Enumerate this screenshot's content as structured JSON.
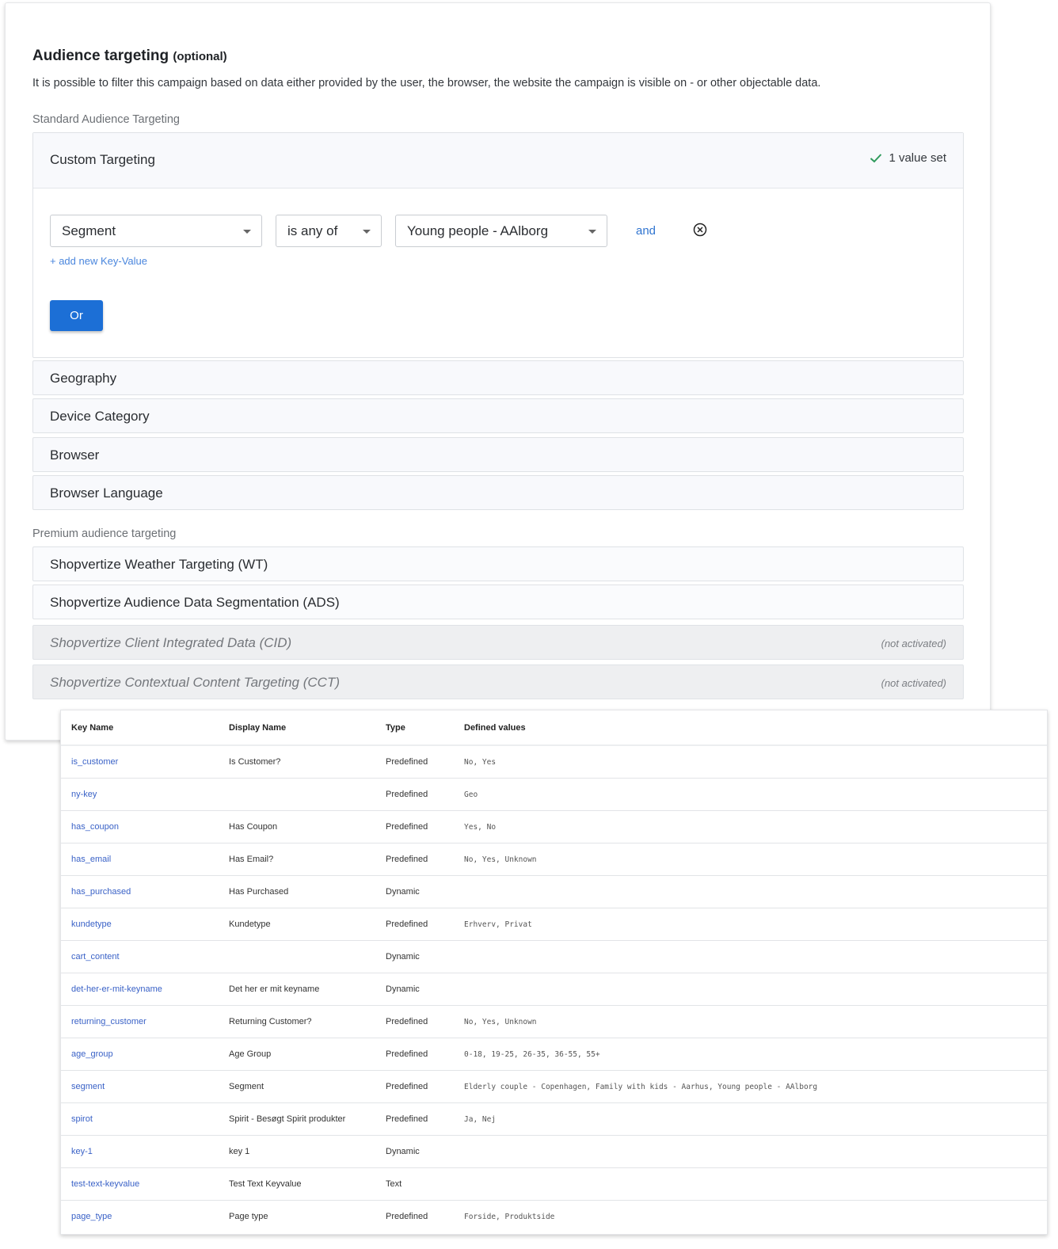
{
  "header": {
    "title": "Audience targeting",
    "title_suffix": "(optional)",
    "description": "It is possible to filter this campaign based on data either provided by the user, the browser, the website the campaign is visible on - or other objectable data."
  },
  "standard": {
    "label": "Standard Audience Targeting",
    "custom": {
      "label": "Custom Targeting",
      "status": "1 value set",
      "status_color": "#2e9a5b",
      "key_select": "Segment",
      "operator_select": "is any of",
      "value_select": "Young people - AAlborg",
      "and_label": "and",
      "add_kv_label": "+ add new Key-Value",
      "or_label": "Or"
    },
    "items": [
      {
        "label": "Geography"
      },
      {
        "label": "Device Category"
      },
      {
        "label": "Browser"
      },
      {
        "label": "Browser Language"
      }
    ]
  },
  "premium": {
    "label": "Premium audience targeting",
    "items": [
      {
        "label": "Shopvertize Weather Targeting (WT)",
        "status": ""
      },
      {
        "label": "Shopvertize Audience Data Segmentation (ADS)",
        "status": ""
      },
      {
        "label": "Shopvertize Client Integrated Data (CID)",
        "status": "(not activated)"
      },
      {
        "label": "Shopvertize Contextual Content Targeting (CCT)",
        "status": "(not activated)"
      }
    ]
  },
  "keys_table": {
    "columns": [
      "Key Name",
      "Display Name",
      "Type",
      "Defined values"
    ],
    "rows": [
      [
        "is_customer",
        "Is Customer?",
        "Predefined",
        "No, Yes"
      ],
      [
        "ny-key",
        "",
        "Predefined",
        "Geo"
      ],
      [
        "has_coupon",
        "Has Coupon",
        "Predefined",
        "Yes, No"
      ],
      [
        "has_email",
        "Has Email?",
        "Predefined",
        "No, Yes, Unknown"
      ],
      [
        "has_purchased",
        "Has Purchased",
        "Dynamic",
        ""
      ],
      [
        "kundetype",
        "Kundetype",
        "Predefined",
        "Erhverv, Privat"
      ],
      [
        "cart_content",
        "",
        "Dynamic",
        ""
      ],
      [
        "det-her-er-mit-keyname",
        "Det her er mit keyname",
        "Dynamic",
        ""
      ],
      [
        "returning_customer",
        "Returning Customer?",
        "Predefined",
        "No, Yes, Unknown"
      ],
      [
        "age_group",
        "Age Group",
        "Predefined",
        "0-18, 19-25, 26-35, 36-55, 55+"
      ],
      [
        "segment",
        "Segment",
        "Predefined",
        "Elderly couple - Copenhagen, Family with kids - Aarhus, Young people - AAlborg"
      ],
      [
        "spirot",
        "Spirit - Besøgt Spirit produkter",
        "Predefined",
        "Ja, Nej"
      ],
      [
        "key-1",
        "key 1",
        "Dynamic",
        ""
      ],
      [
        "test-text-keyvalue",
        "Test Text Keyvalue",
        "Text",
        ""
      ],
      [
        "page_type",
        "Page type",
        "Predefined",
        "Forside, Produktside"
      ]
    ]
  }
}
